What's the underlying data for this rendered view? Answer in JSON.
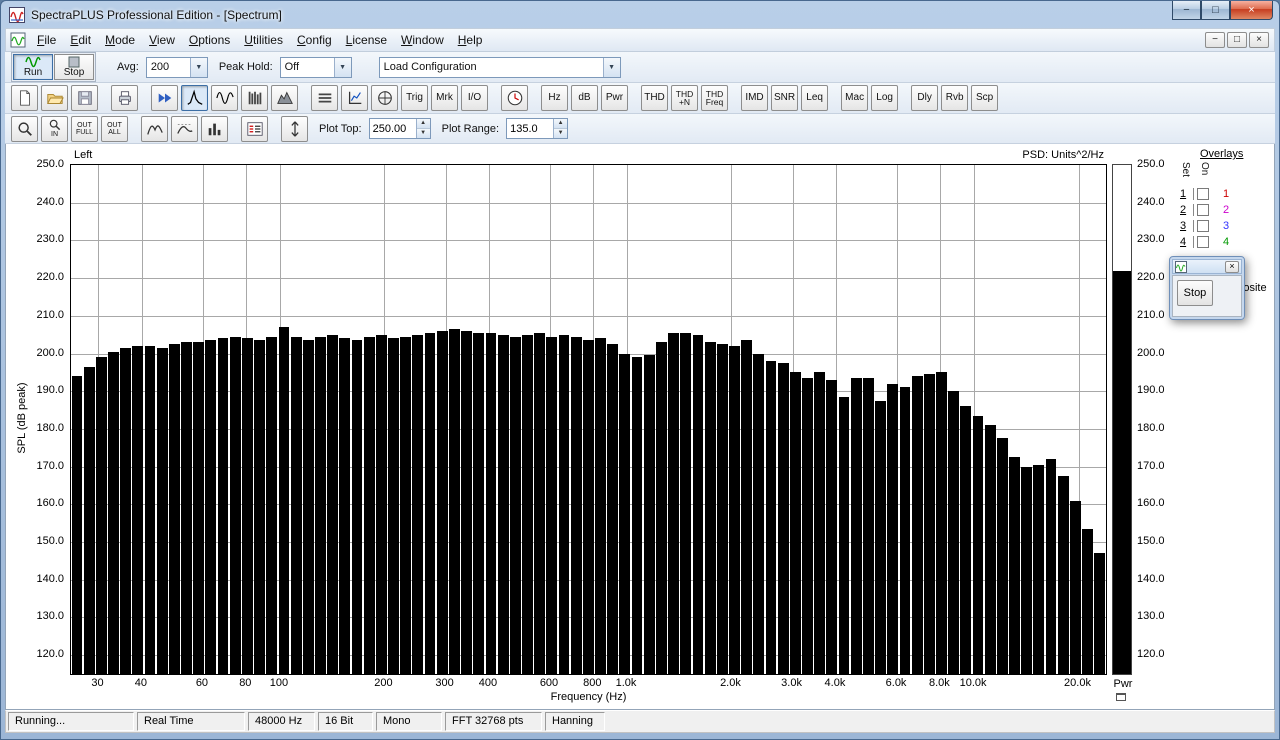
{
  "window": {
    "title": "SpectraPLUS Professional Edition - [Spectrum]",
    "minimize_glyph": "−",
    "maximize_glyph": "□",
    "close_glyph": "×"
  },
  "menu": {
    "items": [
      "File",
      "Edit",
      "Mode",
      "View",
      "Options",
      "Utilities",
      "Config",
      "License",
      "Window",
      "Help"
    ]
  },
  "mdi": {
    "minimize_glyph": "−",
    "restore_glyph": "□",
    "close_glyph": "×"
  },
  "toolbar1": {
    "run": "Run",
    "stop": "Stop",
    "avg_label": "Avg:",
    "avg_value": "200",
    "peak_hold_label": "Peak Hold:",
    "peak_hold_value": "Off",
    "load_config_value": "Load Configuration"
  },
  "toolbar2": {
    "trig": "Trig",
    "mrk": "Mrk",
    "io": "I/O",
    "hz": "Hz",
    "db": "dB",
    "pwr": "Pwr",
    "thd": "THD",
    "thd_n_line1": "THD",
    "thd_n_line2": "+N",
    "thd_freq_line1": "THD",
    "thd_freq_line2": "Freq",
    "imd": "IMD",
    "snr": "SNR",
    "leq": "Leq",
    "mac": "Mac",
    "log": "Log",
    "dly": "Dly",
    "rvb": "Rvb",
    "scp": "Scp"
  },
  "toolbar3": {
    "zoom_in_label": "IN",
    "zoom_out_line1": "OUT",
    "zoom_out_line2": "FULL",
    "zoom_all_line1": "OUT",
    "zoom_all_line2": "ALL",
    "plot_top_label": "Plot Top:",
    "plot_top_value": "250.00",
    "plot_range_label": "Plot Range:",
    "plot_range_value": "135.0"
  },
  "chart_data": {
    "type": "bar",
    "channel_label": "Left",
    "psd_label": "PSD: Units^2/Hz",
    "ylabel": "SPL (dB peak)",
    "xlabel": "Frequency (Hz)",
    "ylim": [
      115,
      250
    ],
    "plot_top": 250.0,
    "plot_range": 135.0,
    "y_ticks": [
      250,
      240,
      230,
      220,
      210,
      200,
      190,
      180,
      170,
      160,
      150,
      140,
      130,
      120
    ],
    "x_ticks": [
      [
        30,
        "30"
      ],
      [
        40,
        "40"
      ],
      [
        60,
        "60"
      ],
      [
        80,
        "80"
      ],
      [
        100,
        "100"
      ],
      [
        200,
        "200"
      ],
      [
        300,
        "300"
      ],
      [
        400,
        "400"
      ],
      [
        600,
        "600"
      ],
      [
        800,
        "800"
      ],
      [
        1000,
        "1.0k"
      ],
      [
        2000,
        "2.0k"
      ],
      [
        3000,
        "3.0k"
      ],
      [
        4000,
        "4.0k"
      ],
      [
        6000,
        "6.0k"
      ],
      [
        8000,
        "8.0k"
      ],
      [
        10000,
        "10.0k"
      ],
      [
        20000,
        "20.0k"
      ]
    ],
    "x_range_hz": [
      25,
      24000
    ],
    "values": [
      194,
      196.5,
      199,
      200.5,
      201.5,
      202,
      202,
      201.5,
      202.5,
      203,
      203,
      203.5,
      204,
      204.5,
      204,
      203.5,
      204.5,
      207,
      204.5,
      203.5,
      204.5,
      205,
      204,
      203.5,
      204.5,
      205,
      204,
      204.5,
      205,
      205.5,
      206,
      206.5,
      206,
      205.5,
      205.5,
      205,
      204.5,
      205,
      205.5,
      204.5,
      205,
      204.5,
      203.5,
      204,
      202.5,
      200,
      199,
      199.5,
      203,
      205.5,
      205.5,
      205,
      203,
      202.5,
      202,
      203.5,
      200,
      198,
      197.5,
      195,
      193.5,
      195,
      193,
      188.5,
      193.5,
      193.5,
      187.5,
      192,
      191,
      194,
      194.5,
      195,
      190,
      186,
      183.5,
      181,
      177.5,
      172.5,
      170,
      170.5,
      172,
      167.5,
      161,
      153.5,
      147
    ],
    "pwr_label": "Pwr",
    "pwr_value": 222
  },
  "overlays": {
    "title": "Overlays",
    "col_set": "Set",
    "col_on": "On",
    "rows": [
      {
        "num": "1",
        "color": "#cc0000"
      },
      {
        "num": "2",
        "color": "#cc00cc"
      },
      {
        "num": "3",
        "color": "#3333ff"
      },
      {
        "num": "4",
        "color": "#009900"
      }
    ],
    "composite_label": "Composite"
  },
  "floating_toolbar": {
    "stop_label": "Stop",
    "close_glyph": "×"
  },
  "status_bar": {
    "items": [
      "Running...",
      "Real Time",
      "48000 Hz",
      "16 Bit",
      "Mono",
      "FFT 32768 pts",
      "Hanning"
    ]
  }
}
